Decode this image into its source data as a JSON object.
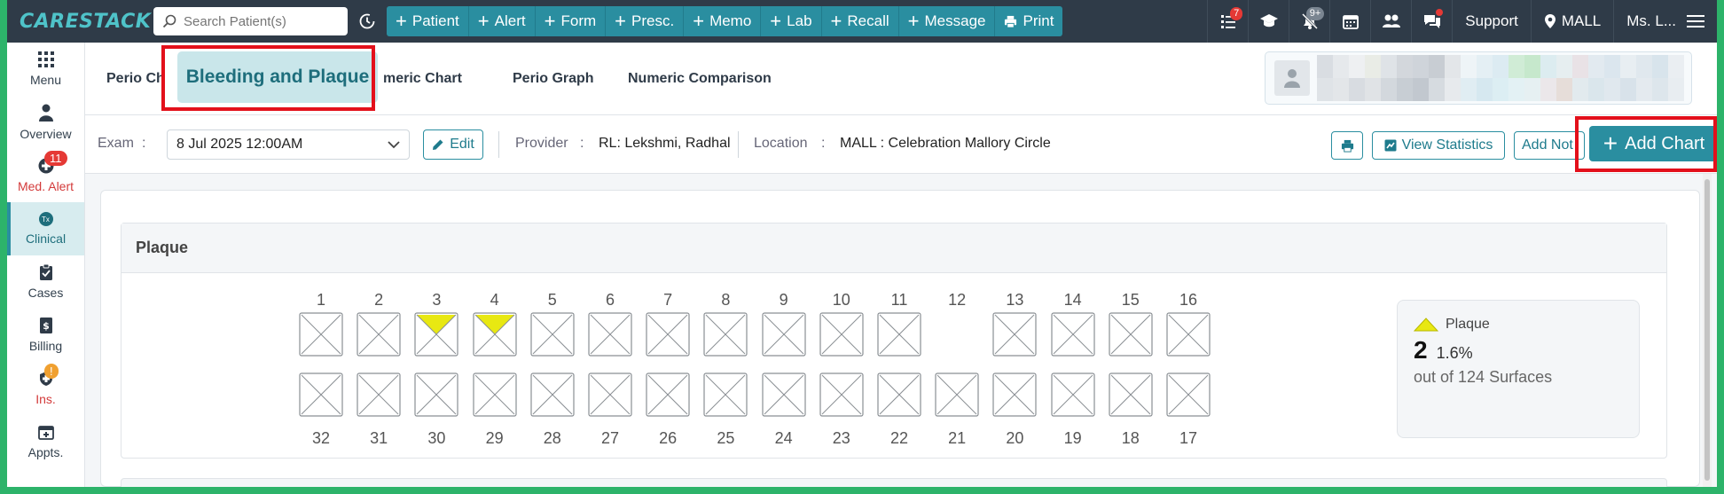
{
  "app": {
    "logo": "CARESTACK"
  },
  "search": {
    "placeholder": "Search Patient(s)"
  },
  "quick_actions": [
    "Patient",
    "Alert",
    "Form",
    "Presc.",
    "Memo",
    "Lab",
    "Recall",
    "Message",
    "Print"
  ],
  "top_right": {
    "tasks_badge": "7",
    "notifications_badge": "9+",
    "support": "Support",
    "location": "MALL",
    "user": "Ms. L..."
  },
  "sidebar": {
    "items": [
      {
        "label": "Menu"
      },
      {
        "label": "Overview"
      },
      {
        "label": "Med. Alert",
        "badge": "11"
      },
      {
        "label": "Clinical",
        "icon_text": "Tx"
      },
      {
        "label": "Cases"
      },
      {
        "label": "Billing"
      },
      {
        "label": "Ins.",
        "badge": "!"
      },
      {
        "label": "Appts."
      }
    ]
  },
  "tabs": {
    "perio_chart": "Perio Ch",
    "bleeding_plaque": "Bleeding and Plaque",
    "numeric_chart": "meric Chart",
    "perio_graph": "Perio Graph",
    "numeric_comparison": "Numeric Comparison"
  },
  "exam_bar": {
    "exam_label": "Exam",
    "exam_value": "8 Jul 2025 12:00AM",
    "edit": "Edit",
    "provider_label": "Provider",
    "provider_value": "RL: Lekshmi, Radhal",
    "location_label": "Location",
    "location_value": "MALL : Celebration Mallory Circle",
    "view_statistics": "View Statistics",
    "add_note": "Add Not",
    "add_chart": "Add Chart"
  },
  "plaque": {
    "title": "Plaque",
    "upper_teeth": [
      "1",
      "2",
      "3",
      "4",
      "5",
      "6",
      "7",
      "8",
      "9",
      "10",
      "11",
      "12",
      "13",
      "14",
      "15",
      "16"
    ],
    "lower_teeth": [
      "32",
      "31",
      "30",
      "29",
      "28",
      "27",
      "26",
      "25",
      "24",
      "23",
      "22",
      "21",
      "20",
      "19",
      "18",
      "17"
    ],
    "plaque_teeth": [
      "3",
      "4"
    ],
    "missing_teeth": [
      "12"
    ],
    "stats": {
      "label": "Plaque",
      "count": "2",
      "percent": "1.6%",
      "surfaces": "out of 124 Surfaces"
    }
  },
  "colors": {
    "accent": "#2a8ea0",
    "plaque": "#e8e812",
    "highlight": "#e3101b"
  }
}
